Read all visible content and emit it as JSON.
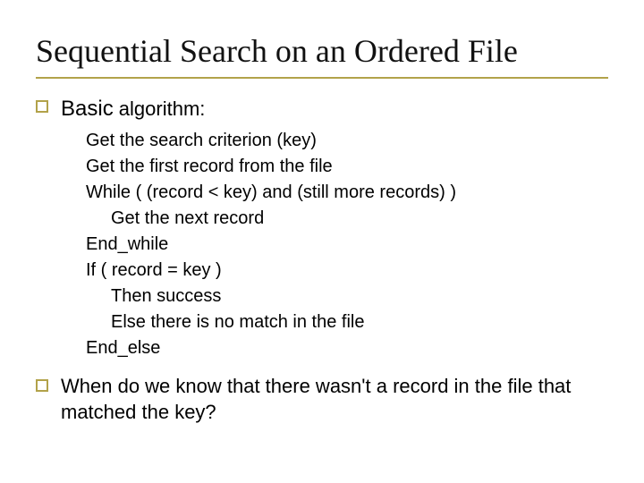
{
  "title": "Sequential Search on an Ordered File",
  "bullet1": {
    "strong": "Basic",
    "rest": " algorithm:"
  },
  "algorithm": {
    "l0": "Get the search criterion (key)",
    "l1": "Get the first record from the file",
    "l2": "While ( (record < key)  and  (still more records) )",
    "l3": "Get the next record",
    "l4": "End_while",
    "l5": "If ( record = key )",
    "l6": "Then success",
    "l7": "Else there is no match in the file",
    "l8": "End_else"
  },
  "bullet2": "When do we know that there wasn't a record in the file that matched the key?"
}
